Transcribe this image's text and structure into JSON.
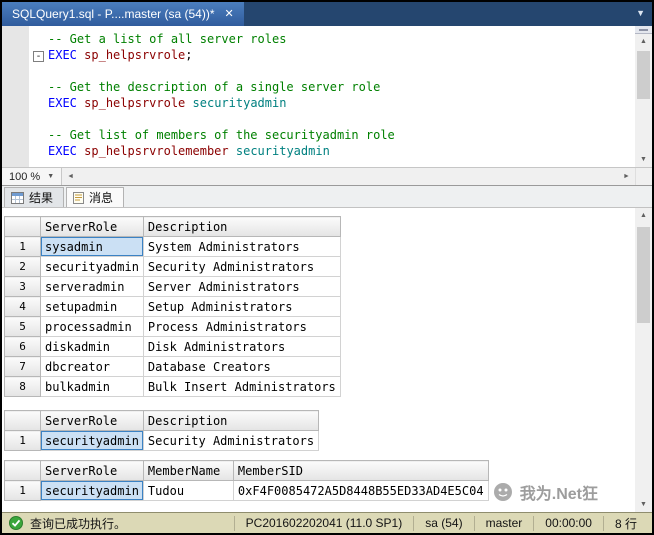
{
  "icons": {
    "close": "✕",
    "dropdown": "▼",
    "up": "▲",
    "down": "▼",
    "left": "◄",
    "right": "►",
    "minus": "-",
    "check": "✓"
  },
  "window": {
    "tab_title": "SQLQuery1.sql - P....master (sa (54))*"
  },
  "editor": {
    "zoom": "100 %",
    "lines": [
      [
        {
          "t": "-- Get a list of all server roles",
          "c": "comment"
        }
      ],
      [
        {
          "t": "EXEC",
          "c": "keyword"
        },
        {
          "t": " ",
          "c": "plain"
        },
        {
          "t": "sp_helpsrvrole",
          "c": "sproc"
        },
        {
          "t": ";",
          "c": "plain"
        }
      ],
      [],
      [
        {
          "t": "-- Get the description of a single server role",
          "c": "comment"
        }
      ],
      [
        {
          "t": "EXEC",
          "c": "keyword"
        },
        {
          "t": " ",
          "c": "plain"
        },
        {
          "t": "sp_helpsrvrole",
          "c": "sproc"
        },
        {
          "t": " ",
          "c": "plain"
        },
        {
          "t": "securityadmin",
          "c": "ident"
        }
      ],
      [],
      [
        {
          "t": "-- Get list of members of the securityadmin role",
          "c": "comment"
        }
      ],
      [
        {
          "t": "EXEC",
          "c": "keyword"
        },
        {
          "t": " ",
          "c": "plain"
        },
        {
          "t": "sp_helpsrvrolemember",
          "c": "sproc"
        },
        {
          "t": " ",
          "c": "plain"
        },
        {
          "t": "securityadmin",
          "c": "ident"
        }
      ]
    ]
  },
  "results": {
    "tabs": [
      {
        "label": "结果"
      },
      {
        "label": "消息"
      }
    ],
    "grids": [
      {
        "columns": [
          "ServerRole",
          "Description"
        ],
        "rows": [
          [
            "sysadmin",
            "System Administrators"
          ],
          [
            "securityadmin",
            "Security Administrators"
          ],
          [
            "serveradmin",
            "Server Administrators"
          ],
          [
            "setupadmin",
            "Setup Administrators"
          ],
          [
            "processadmin",
            "Process Administrators"
          ],
          [
            "diskadmin",
            "Disk Administrators"
          ],
          [
            "dbcreator",
            "Database Creators"
          ],
          [
            "bulkadmin",
            "Bulk Insert Administrators"
          ]
        ],
        "selected": [
          0,
          0
        ]
      },
      {
        "columns": [
          "ServerRole",
          "Description"
        ],
        "rows": [
          [
            "securityadmin",
            "Security Administrators"
          ]
        ],
        "selected": [
          0,
          0
        ]
      },
      {
        "columns": [
          "ServerRole",
          "MemberName",
          "MemberSID"
        ],
        "rows": [
          [
            "securityadmin",
            "Tudou",
            "0xF4F0085472A5D8448B55ED33AD4E5C04"
          ]
        ],
        "selected": [
          0,
          0
        ]
      }
    ]
  },
  "watermark": {
    "text": "我为.Net狂"
  },
  "statusbar": {
    "message": "查询已成功执行。",
    "server": "PC201602202041 (11.0 SP1)",
    "user": "sa (54)",
    "database": "master",
    "time": "00:00:00",
    "rows": "8 行"
  }
}
